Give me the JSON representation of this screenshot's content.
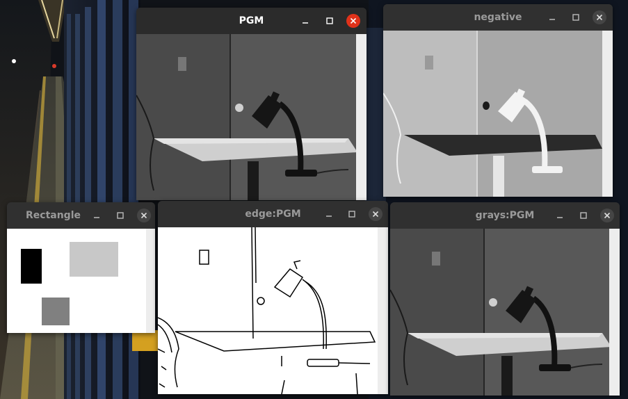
{
  "windows": {
    "pgm": {
      "title": "PGM",
      "active": true
    },
    "negative": {
      "title": "negative",
      "active": false
    },
    "rectangle": {
      "title": "Rectangle",
      "active": false
    },
    "edge": {
      "title": "edge:PGM",
      "active": false
    },
    "grays": {
      "title": "grays:PGM",
      "active": false
    }
  },
  "controls": {
    "minimize": "minimize-icon",
    "maximize": "maximize-icon",
    "close": "close-icon"
  },
  "colors": {
    "titlebar": "#303030",
    "close_active": "#e0321a",
    "title_active": "#ffffff",
    "title_inactive": "#9a9a9a",
    "rect_black": "#000000",
    "rect_light_gray": "#c8c8c8",
    "rect_mid_gray": "#808080"
  }
}
